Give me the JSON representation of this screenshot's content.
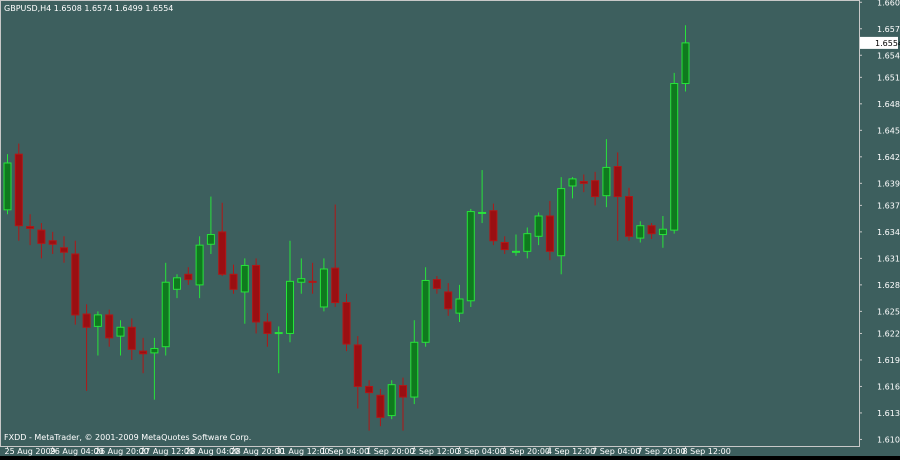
{
  "window": {
    "symbol_info": "GBPUSD,H4  1.6508 1.6574 1.6499 1.6554",
    "copyright": "FXDD - MetaTrader, © 2001-2009 MetaQuotes Software Corp."
  },
  "colors": {
    "background": "#3D5F5E",
    "frame": "#C8C8C8",
    "bull_fill": "#0F7A1E",
    "bull_wick": "#27E33A",
    "bear_fill": "#9A0F12",
    "bear_wick": "#B21616",
    "text": "#FFFFFF",
    "price_tag_bg": "#FFFFFF",
    "price_tag_text": "#000000"
  },
  "chart_data": {
    "type": "candlestick",
    "symbol": "GBPUSD",
    "timeframe": "H4",
    "current_price": "1.6554",
    "ylim": [
      1.6097,
      1.6602
    ],
    "y_ticks": [
      "1.6600",
      "1.6570",
      "1.6540",
      "1.6515",
      "1.6485",
      "1.6455",
      "1.6425",
      "1.6395",
      "1.6370",
      "1.6340",
      "1.6310",
      "1.6280",
      "1.6250",
      "1.6225",
      "1.6195",
      "1.6165",
      "1.6135",
      "1.6105"
    ],
    "x_ticks": [
      {
        "label": "25 Aug 2009",
        "index": 0
      },
      {
        "label": "26 Aug 04:00",
        "index": 4
      },
      {
        "label": "26 Aug 20:00",
        "index": 8
      },
      {
        "label": "27 Aug 12:00",
        "index": 12
      },
      {
        "label": "28 Aug 04:00",
        "index": 16
      },
      {
        "label": "28 Aug 20:00",
        "index": 20
      },
      {
        "label": "31 Aug 12:00",
        "index": 24
      },
      {
        "label": "1 Sep 04:00",
        "index": 28
      },
      {
        "label": "1 Sep 20:00",
        "index": 32
      },
      {
        "label": "2 Sep 12:00",
        "index": 36
      },
      {
        "label": "3 Sep 04:00",
        "index": 40
      },
      {
        "label": "3 Sep 20:00",
        "index": 44
      },
      {
        "label": "4 Sep 12:00",
        "index": 48
      },
      {
        "label": "7 Sep 04:00",
        "index": 52
      },
      {
        "label": "7 Sep 20:00",
        "index": 56
      },
      {
        "label": "8 Sep 12:00",
        "index": 60
      }
    ],
    "candles": [
      {
        "o": 1.6365,
        "h": 1.6428,
        "l": 1.636,
        "c": 1.6418
      },
      {
        "o": 1.6428,
        "h": 1.644,
        "l": 1.633,
        "c": 1.6347
      },
      {
        "o": 1.6346,
        "h": 1.636,
        "l": 1.6325,
        "c": 1.6344
      },
      {
        "o": 1.6342,
        "h": 1.635,
        "l": 1.631,
        "c": 1.6327
      },
      {
        "o": 1.633,
        "h": 1.634,
        "l": 1.6315,
        "c": 1.6326
      },
      {
        "o": 1.6322,
        "h": 1.6335,
        "l": 1.6305,
        "c": 1.6317
      },
      {
        "o": 1.6315,
        "h": 1.633,
        "l": 1.6235,
        "c": 1.6246
      },
      {
        "o": 1.6247,
        "h": 1.6258,
        "l": 1.616,
        "c": 1.6232
      },
      {
        "o": 1.6233,
        "h": 1.625,
        "l": 1.62,
        "c": 1.6246
      },
      {
        "o": 1.6246,
        "h": 1.6252,
        "l": 1.621,
        "c": 1.622
      },
      {
        "o": 1.6222,
        "h": 1.624,
        "l": 1.62,
        "c": 1.6232
      },
      {
        "o": 1.6232,
        "h": 1.6242,
        "l": 1.6195,
        "c": 1.6207
      },
      {
        "o": 1.6205,
        "h": 1.622,
        "l": 1.618,
        "c": 1.6202
      },
      {
        "o": 1.6203,
        "h": 1.622,
        "l": 1.615,
        "c": 1.6208
      },
      {
        "o": 1.621,
        "h": 1.6305,
        "l": 1.62,
        "c": 1.6283
      },
      {
        "o": 1.6275,
        "h": 1.6292,
        "l": 1.6265,
        "c": 1.6288
      },
      {
        "o": 1.6292,
        "h": 1.63,
        "l": 1.628,
        "c": 1.6286
      },
      {
        "o": 1.628,
        "h": 1.6335,
        "l": 1.6265,
        "c": 1.6325
      },
      {
        "o": 1.6326,
        "h": 1.638,
        "l": 1.6315,
        "c": 1.6337
      },
      {
        "o": 1.634,
        "h": 1.6373,
        "l": 1.629,
        "c": 1.6292
      },
      {
        "o": 1.6292,
        "h": 1.6303,
        "l": 1.627,
        "c": 1.6275
      },
      {
        "o": 1.6272,
        "h": 1.631,
        "l": 1.6236,
        "c": 1.6302
      },
      {
        "o": 1.6302,
        "h": 1.631,
        "l": 1.6225,
        "c": 1.6238
      },
      {
        "o": 1.6238,
        "h": 1.6248,
        "l": 1.621,
        "c": 1.6225
      },
      {
        "o": 1.6226,
        "h": 1.6233,
        "l": 1.618,
        "c": 1.6226
      },
      {
        "o": 1.6225,
        "h": 1.633,
        "l": 1.6215,
        "c": 1.6284
      },
      {
        "o": 1.6283,
        "h": 1.631,
        "l": 1.627,
        "c": 1.6287
      },
      {
        "o": 1.6284,
        "h": 1.6305,
        "l": 1.627,
        "c": 1.6283
      },
      {
        "o": 1.6255,
        "h": 1.631,
        "l": 1.625,
        "c": 1.6298
      },
      {
        "o": 1.6299,
        "h": 1.6371,
        "l": 1.6255,
        "c": 1.626
      },
      {
        "o": 1.626,
        "h": 1.627,
        "l": 1.6205,
        "c": 1.6213
      },
      {
        "o": 1.6212,
        "h": 1.6222,
        "l": 1.614,
        "c": 1.6165
      },
      {
        "o": 1.6165,
        "h": 1.6172,
        "l": 1.6115,
        "c": 1.6158
      },
      {
        "o": 1.6155,
        "h": 1.6162,
        "l": 1.612,
        "c": 1.613
      },
      {
        "o": 1.6132,
        "h": 1.6172,
        "l": 1.6128,
        "c": 1.6167
      },
      {
        "o": 1.6166,
        "h": 1.6175,
        "l": 1.6115,
        "c": 1.6153
      },
      {
        "o": 1.6153,
        "h": 1.624,
        "l": 1.6145,
        "c": 1.6215
      },
      {
        "o": 1.6215,
        "h": 1.63,
        "l": 1.621,
        "c": 1.6285
      },
      {
        "o": 1.6286,
        "h": 1.629,
        "l": 1.627,
        "c": 1.6276
      },
      {
        "o": 1.6272,
        "h": 1.6282,
        "l": 1.6245,
        "c": 1.6253
      },
      {
        "o": 1.6248,
        "h": 1.628,
        "l": 1.6238,
        "c": 1.6264
      },
      {
        "o": 1.6262,
        "h": 1.6366,
        "l": 1.6255,
        "c": 1.6363
      },
      {
        "o": 1.6362,
        "h": 1.641,
        "l": 1.635,
        "c": 1.6362
      },
      {
        "o": 1.6364,
        "h": 1.6372,
        "l": 1.6325,
        "c": 1.633
      },
      {
        "o": 1.6328,
        "h": 1.6335,
        "l": 1.6315,
        "c": 1.632
      },
      {
        "o": 1.6317,
        "h": 1.6337,
        "l": 1.6313,
        "c": 1.6318
      },
      {
        "o": 1.6318,
        "h": 1.6345,
        "l": 1.631,
        "c": 1.6338
      },
      {
        "o": 1.6335,
        "h": 1.6362,
        "l": 1.6325,
        "c": 1.6358
      },
      {
        "o": 1.6358,
        "h": 1.6375,
        "l": 1.6308,
        "c": 1.6318
      },
      {
        "o": 1.6313,
        "h": 1.6402,
        "l": 1.6292,
        "c": 1.6389
      },
      {
        "o": 1.6392,
        "h": 1.6402,
        "l": 1.6378,
        "c": 1.64
      },
      {
        "o": 1.6397,
        "h": 1.6405,
        "l": 1.6385,
        "c": 1.6395
      },
      {
        "o": 1.6398,
        "h": 1.6408,
        "l": 1.637,
        "c": 1.638
      },
      {
        "o": 1.6381,
        "h": 1.6445,
        "l": 1.6368,
        "c": 1.6413
      },
      {
        "o": 1.6414,
        "h": 1.643,
        "l": 1.633,
        "c": 1.638
      },
      {
        "o": 1.638,
        "h": 1.639,
        "l": 1.633,
        "c": 1.6335
      },
      {
        "o": 1.6333,
        "h": 1.6352,
        "l": 1.6328,
        "c": 1.6347
      },
      {
        "o": 1.6347,
        "h": 1.635,
        "l": 1.6332,
        "c": 1.6338
      },
      {
        "o": 1.6337,
        "h": 1.6358,
        "l": 1.6322,
        "c": 1.6343
      },
      {
        "o": 1.6342,
        "h": 1.652,
        "l": 1.6338,
        "c": 1.6508
      },
      {
        "o": 1.6508,
        "h": 1.6574,
        "l": 1.6499,
        "c": 1.6554
      }
    ]
  }
}
